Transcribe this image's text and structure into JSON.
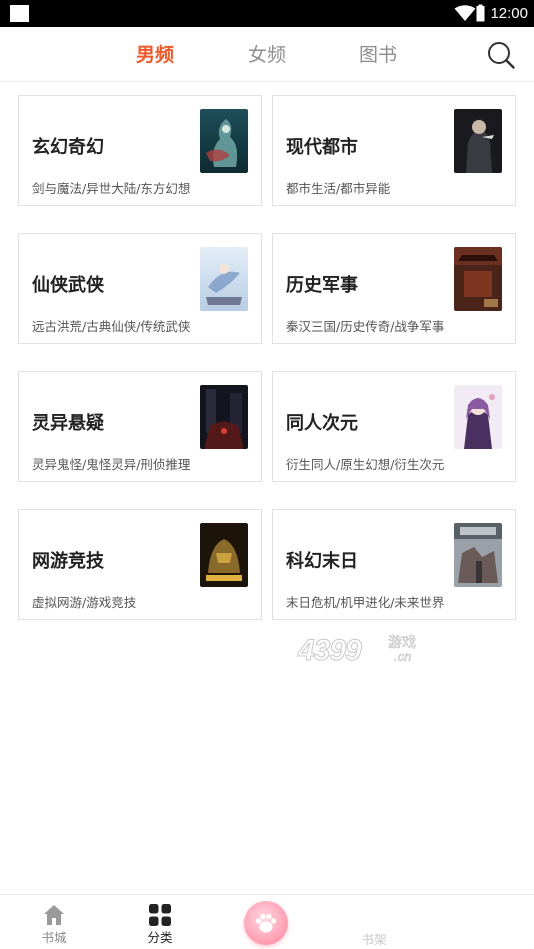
{
  "status_bar": {
    "time": "12:00"
  },
  "top_tabs": [
    {
      "label": "男频",
      "active": true
    },
    {
      "label": "女频",
      "active": false
    },
    {
      "label": "图书",
      "active": false
    }
  ],
  "categories": [
    {
      "title": "玄幻奇幻",
      "subs": "剑与魔法/异世大陆/东方幻想"
    },
    {
      "title": "现代都市",
      "subs": "都市生活/都市异能"
    },
    {
      "title": "仙侠武侠",
      "subs": "远古洪荒/古典仙侠/传统武侠"
    },
    {
      "title": "历史军事",
      "subs": "秦汉三国/历史传奇/战争军事"
    },
    {
      "title": "灵异悬疑",
      "subs": "灵异鬼怪/鬼怪灵异/刑侦推理"
    },
    {
      "title": "同人次元",
      "subs": "衍生同人/原生幻想/衍生次元"
    },
    {
      "title": "网游竞技",
      "subs": "虚拟网游/游戏竞技"
    },
    {
      "title": "科幻末日",
      "subs": "末日危机/机甲进化/未来世界"
    }
  ],
  "watermark": {
    "number": "4399",
    "text_cn": "游戏",
    "domain": ".cn"
  },
  "bottom_nav": [
    {
      "label": "书城",
      "icon": "home-icon",
      "active": false
    },
    {
      "label": "分类",
      "icon": "grid-icon",
      "active": true
    },
    {
      "label": "书架",
      "icon": "bookshelf-icon",
      "active": false
    }
  ],
  "colors": {
    "accent": "#ee5a2b",
    "inactive_tab": "#8e8e8e",
    "paw_button": "#ff9bb1"
  }
}
